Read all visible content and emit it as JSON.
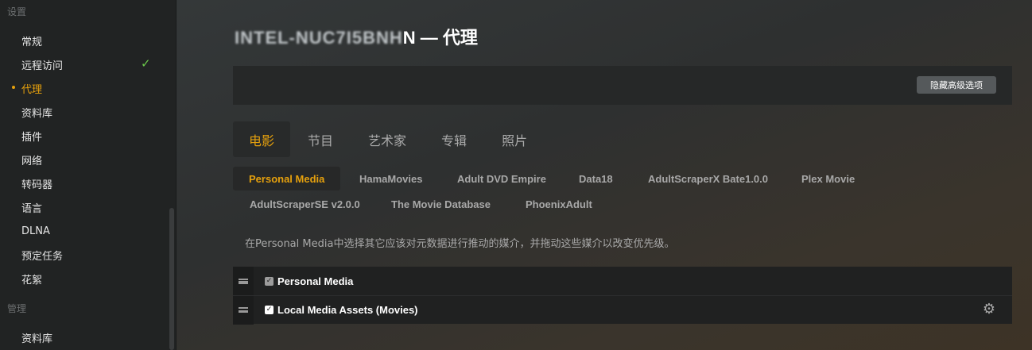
{
  "sidebar": {
    "settings_title": "设置",
    "manage_title": "管理",
    "items": [
      {
        "label": "常规"
      },
      {
        "label": "远程访问",
        "check": "✓"
      },
      {
        "label": "代理"
      },
      {
        "label": "资料库"
      },
      {
        "label": "插件"
      },
      {
        "label": "网络"
      },
      {
        "label": "转码器"
      },
      {
        "label": "语言"
      },
      {
        "label": "DLNA"
      },
      {
        "label": "预定任务"
      },
      {
        "label": "花絮"
      }
    ],
    "manage_items": [
      {
        "label": "资料库"
      }
    ]
  },
  "header": {
    "server_name": "INTEL-NUC7I5BNH",
    "title_suffix": "N — 代理"
  },
  "toolbar": {
    "hide_advanced_label": "隐藏高级选项"
  },
  "tabs": [
    {
      "label": "电影"
    },
    {
      "label": "节目"
    },
    {
      "label": "艺术家"
    },
    {
      "label": "专辑"
    },
    {
      "label": "照片"
    }
  ],
  "agents": [
    {
      "label": "Personal Media"
    },
    {
      "label": "HamaMovies"
    },
    {
      "label": "Adult DVD Empire"
    },
    {
      "label": "Data18"
    },
    {
      "label": "AdultScraperX Bate1.0.0"
    },
    {
      "label": "Plex Movie"
    },
    {
      "label": "AdultScraperSE v2.0.0"
    },
    {
      "label": "The Movie Database"
    },
    {
      "label": "PhoenixAdult"
    }
  ],
  "description": "在Personal Media中选择其它应该对元数据进行推动的媒介，并拖动这些媒介以改变优先级。",
  "sources": [
    {
      "label": "Personal Media",
      "checked": true,
      "disabled": true
    },
    {
      "label": "Local Media Assets (Movies)",
      "checked": true,
      "disabled": false
    }
  ],
  "colors": {
    "accent": "#e5a00d",
    "check": "#6bc84b"
  }
}
